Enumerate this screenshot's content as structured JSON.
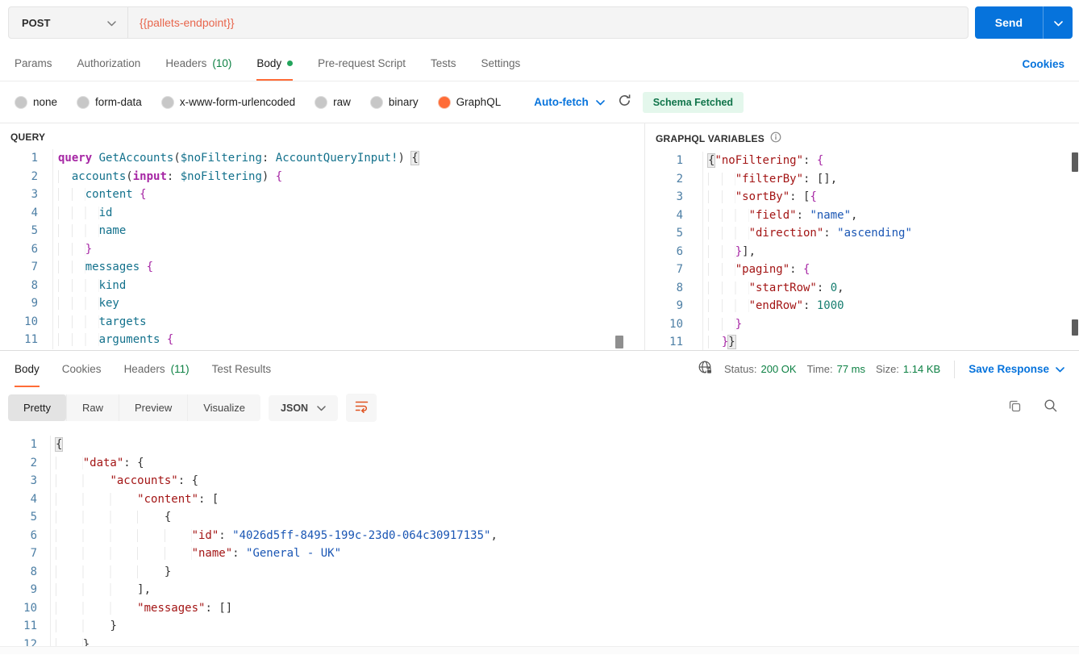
{
  "request_bar": {
    "method": "POST",
    "url": "{{pallets-endpoint}}",
    "send": "Send"
  },
  "tabs": {
    "items": [
      {
        "label": "Params"
      },
      {
        "label": "Authorization"
      },
      {
        "label": "Headers",
        "count": "(10)"
      },
      {
        "label": "Body",
        "dot": true,
        "active": true
      },
      {
        "label": "Pre-request Script"
      },
      {
        "label": "Tests"
      },
      {
        "label": "Settings"
      }
    ],
    "cookies": "Cookies"
  },
  "body_modes": {
    "options": [
      {
        "label": "none"
      },
      {
        "label": "form-data"
      },
      {
        "label": "x-www-form-urlencoded"
      },
      {
        "label": "raw"
      },
      {
        "label": "binary"
      },
      {
        "label": "GraphQL",
        "selected": true
      }
    ],
    "autofetch": "Auto-fetch",
    "schema_badge": "Schema Fetched"
  },
  "query_panel": {
    "title": "QUERY",
    "lines": [
      [
        [
          "kw",
          "query"
        ],
        [
          "p",
          " "
        ],
        [
          "id",
          "GetAccounts"
        ],
        [
          "p",
          "("
        ],
        [
          "id",
          "$noFiltering"
        ],
        [
          "p",
          ": "
        ],
        [
          "id",
          "AccountQueryInput!"
        ],
        [
          "p",
          ") "
        ],
        [
          "bx",
          "{"
        ]
      ],
      [
        [
          "ind",
          "  "
        ],
        [
          "id",
          "accounts"
        ],
        [
          "p",
          "("
        ],
        [
          "kw",
          "input"
        ],
        [
          "p",
          ": "
        ],
        [
          "id",
          "$noFiltering"
        ],
        [
          "p",
          ") "
        ],
        [
          "br",
          "{"
        ]
      ],
      [
        [
          "ind",
          "    "
        ],
        [
          "id",
          "content"
        ],
        [
          "p",
          " "
        ],
        [
          "br",
          "{"
        ]
      ],
      [
        [
          "ind",
          "      "
        ],
        [
          "id",
          "id"
        ]
      ],
      [
        [
          "ind",
          "      "
        ],
        [
          "id",
          "name"
        ]
      ],
      [
        [
          "ind",
          "    "
        ],
        [
          "br",
          "}"
        ]
      ],
      [
        [
          "ind",
          "    "
        ],
        [
          "id",
          "messages"
        ],
        [
          "p",
          " "
        ],
        [
          "br",
          "{"
        ]
      ],
      [
        [
          "ind",
          "      "
        ],
        [
          "id",
          "kind"
        ]
      ],
      [
        [
          "ind",
          "      "
        ],
        [
          "id",
          "key"
        ]
      ],
      [
        [
          "ind",
          "      "
        ],
        [
          "id",
          "targets"
        ]
      ],
      [
        [
          "ind",
          "      "
        ],
        [
          "id",
          "arguments"
        ],
        [
          "p",
          " "
        ],
        [
          "br",
          "{"
        ]
      ]
    ]
  },
  "variables_panel": {
    "title": "GRAPHQL VARIABLES",
    "lines": [
      [
        [
          "bx",
          "{"
        ],
        [
          "k",
          "\"noFiltering\""
        ],
        [
          "p",
          ": "
        ],
        [
          "br",
          "{"
        ]
      ],
      [
        [
          "ind",
          "    "
        ],
        [
          "k",
          "\"filterBy\""
        ],
        [
          "p",
          ": "
        ],
        [
          "p",
          "[],"
        ]
      ],
      [
        [
          "ind",
          "    "
        ],
        [
          "k",
          "\"sortBy\""
        ],
        [
          "p",
          ": "
        ],
        [
          "p",
          "["
        ],
        [
          "br",
          "{"
        ]
      ],
      [
        [
          "ind",
          "      "
        ],
        [
          "k",
          "\"field\""
        ],
        [
          "p",
          ": "
        ],
        [
          "s",
          "\"name\""
        ],
        [
          "p",
          ","
        ]
      ],
      [
        [
          "ind",
          "      "
        ],
        [
          "k",
          "\"direction\""
        ],
        [
          "p",
          ": "
        ],
        [
          "s",
          "\"ascending\""
        ]
      ],
      [
        [
          "ind",
          "    "
        ],
        [
          "br",
          "}"
        ],
        [
          "p",
          "],"
        ]
      ],
      [
        [
          "ind",
          "    "
        ],
        [
          "k",
          "\"paging\""
        ],
        [
          "p",
          ": "
        ],
        [
          "br",
          "{"
        ]
      ],
      [
        [
          "ind",
          "      "
        ],
        [
          "k",
          "\"startRow\""
        ],
        [
          "p",
          ": "
        ],
        [
          "n",
          "0"
        ],
        [
          "p",
          ","
        ]
      ],
      [
        [
          "ind",
          "      "
        ],
        [
          "k",
          "\"endRow\""
        ],
        [
          "p",
          ": "
        ],
        [
          "n",
          "1000"
        ]
      ],
      [
        [
          "ind",
          "    "
        ],
        [
          "br",
          "}"
        ]
      ],
      [
        [
          "ind",
          "  "
        ],
        [
          "br",
          "}"
        ],
        [
          "bx",
          "}"
        ]
      ]
    ]
  },
  "response": {
    "tabs": [
      {
        "label": "Body",
        "active": true
      },
      {
        "label": "Cookies"
      },
      {
        "label": "Headers",
        "count": "(11)"
      },
      {
        "label": "Test Results"
      }
    ],
    "meta": {
      "status_label": "Status:",
      "status": "200 OK",
      "time_label": "Time:",
      "time": "77 ms",
      "size_label": "Size:",
      "size": "1.14 KB",
      "save": "Save Response"
    },
    "views": [
      {
        "label": "Pretty",
        "active": true
      },
      {
        "label": "Raw"
      },
      {
        "label": "Preview"
      },
      {
        "label": "Visualize"
      }
    ],
    "language": "JSON",
    "lines": [
      [
        [
          "bx",
          "{"
        ]
      ],
      [
        [
          "ind",
          "    "
        ],
        [
          "k",
          "\"data\""
        ],
        [
          "p",
          ": "
        ],
        [
          "p",
          "{"
        ]
      ],
      [
        [
          "ind",
          "        "
        ],
        [
          "k",
          "\"accounts\""
        ],
        [
          "p",
          ": "
        ],
        [
          "p",
          "{"
        ]
      ],
      [
        [
          "ind",
          "            "
        ],
        [
          "k",
          "\"content\""
        ],
        [
          "p",
          ": "
        ],
        [
          "p",
          "["
        ]
      ],
      [
        [
          "ind",
          "                "
        ],
        [
          "p",
          "{"
        ]
      ],
      [
        [
          "ind",
          "                    "
        ],
        [
          "k",
          "\"id\""
        ],
        [
          "p",
          ": "
        ],
        [
          "s",
          "\"4026d5ff-8495-199c-23d0-064c30917135\""
        ],
        [
          "p",
          ","
        ]
      ],
      [
        [
          "ind",
          "                    "
        ],
        [
          "k",
          "\"name\""
        ],
        [
          "p",
          ": "
        ],
        [
          "s",
          "\"General - UK\""
        ]
      ],
      [
        [
          "ind",
          "                "
        ],
        [
          "p",
          "}"
        ]
      ],
      [
        [
          "ind",
          "            "
        ],
        [
          "p",
          "],"
        ]
      ],
      [
        [
          "ind",
          "            "
        ],
        [
          "k",
          "\"messages\""
        ],
        [
          "p",
          ": "
        ],
        [
          "p",
          "[]"
        ]
      ],
      [
        [
          "ind",
          "        "
        ],
        [
          "p",
          "}"
        ]
      ],
      [
        [
          "ind",
          "    "
        ],
        [
          "p",
          "}"
        ]
      ]
    ]
  },
  "colors": {
    "orange": "#ff6c37",
    "url": "#e8664d",
    "blue": "#0673dc",
    "green": "#0c8043",
    "dotgreen": "#23a45c",
    "key": "#a31515",
    "str": "#1a56b4",
    "num": "#177e70",
    "kw": "#a626a4",
    "ident": "#13718c",
    "gutter": "#4d7fa5",
    "icon_orange": "#e05320"
  }
}
